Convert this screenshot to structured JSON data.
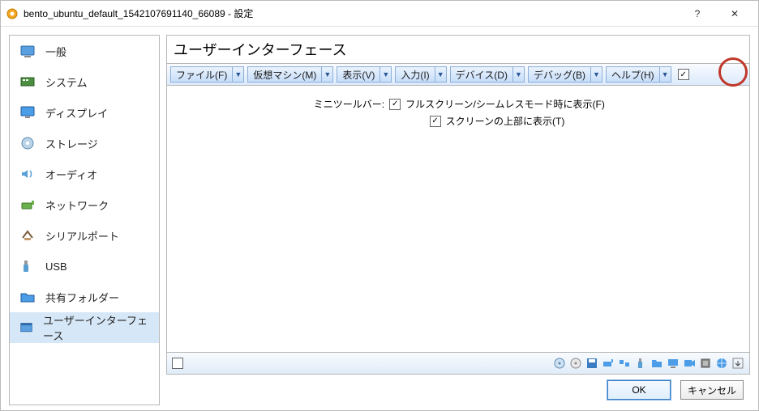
{
  "window": {
    "title": "bento_ubuntu_default_1542107691140_66089 - 設定",
    "help": "?",
    "close": "✕"
  },
  "sidebar": {
    "items": [
      {
        "label": "一般",
        "icon": "general"
      },
      {
        "label": "システム",
        "icon": "system"
      },
      {
        "label": "ディスプレイ",
        "icon": "display"
      },
      {
        "label": "ストレージ",
        "icon": "storage"
      },
      {
        "label": "オーディオ",
        "icon": "audio"
      },
      {
        "label": "ネットワーク",
        "icon": "network"
      },
      {
        "label": "シリアルポート",
        "icon": "serial"
      },
      {
        "label": "USB",
        "icon": "usb"
      },
      {
        "label": "共有フォルダー",
        "icon": "shared"
      },
      {
        "label": "ユーザーインターフェース",
        "icon": "ui"
      }
    ],
    "selected_index": 9
  },
  "page": {
    "title": "ユーザーインターフェース",
    "menus": [
      {
        "label": "ファイル(F)"
      },
      {
        "label": "仮想マシン(M)"
      },
      {
        "label": "表示(V)"
      },
      {
        "label": "入力(I)"
      },
      {
        "label": "デバイス(D)"
      },
      {
        "label": "デバッグ(B)"
      },
      {
        "label": "ヘルプ(H)"
      }
    ],
    "menu_show_checked": true,
    "mini_toolbar_label": "ミニツールバー:",
    "options": [
      {
        "label": "フルスクリーン/シームレスモード時に表示(F)",
        "checked": true
      },
      {
        "label": "スクリーンの上部に表示(T)",
        "checked": true
      }
    ],
    "status_icons": [
      "hdd",
      "disc",
      "save",
      "network1",
      "network2",
      "usb",
      "folder",
      "display2",
      "video",
      "chip",
      "globe",
      "arrow"
    ],
    "status_checked": false
  },
  "footer": {
    "ok": "OK",
    "cancel": "キャンセル"
  }
}
